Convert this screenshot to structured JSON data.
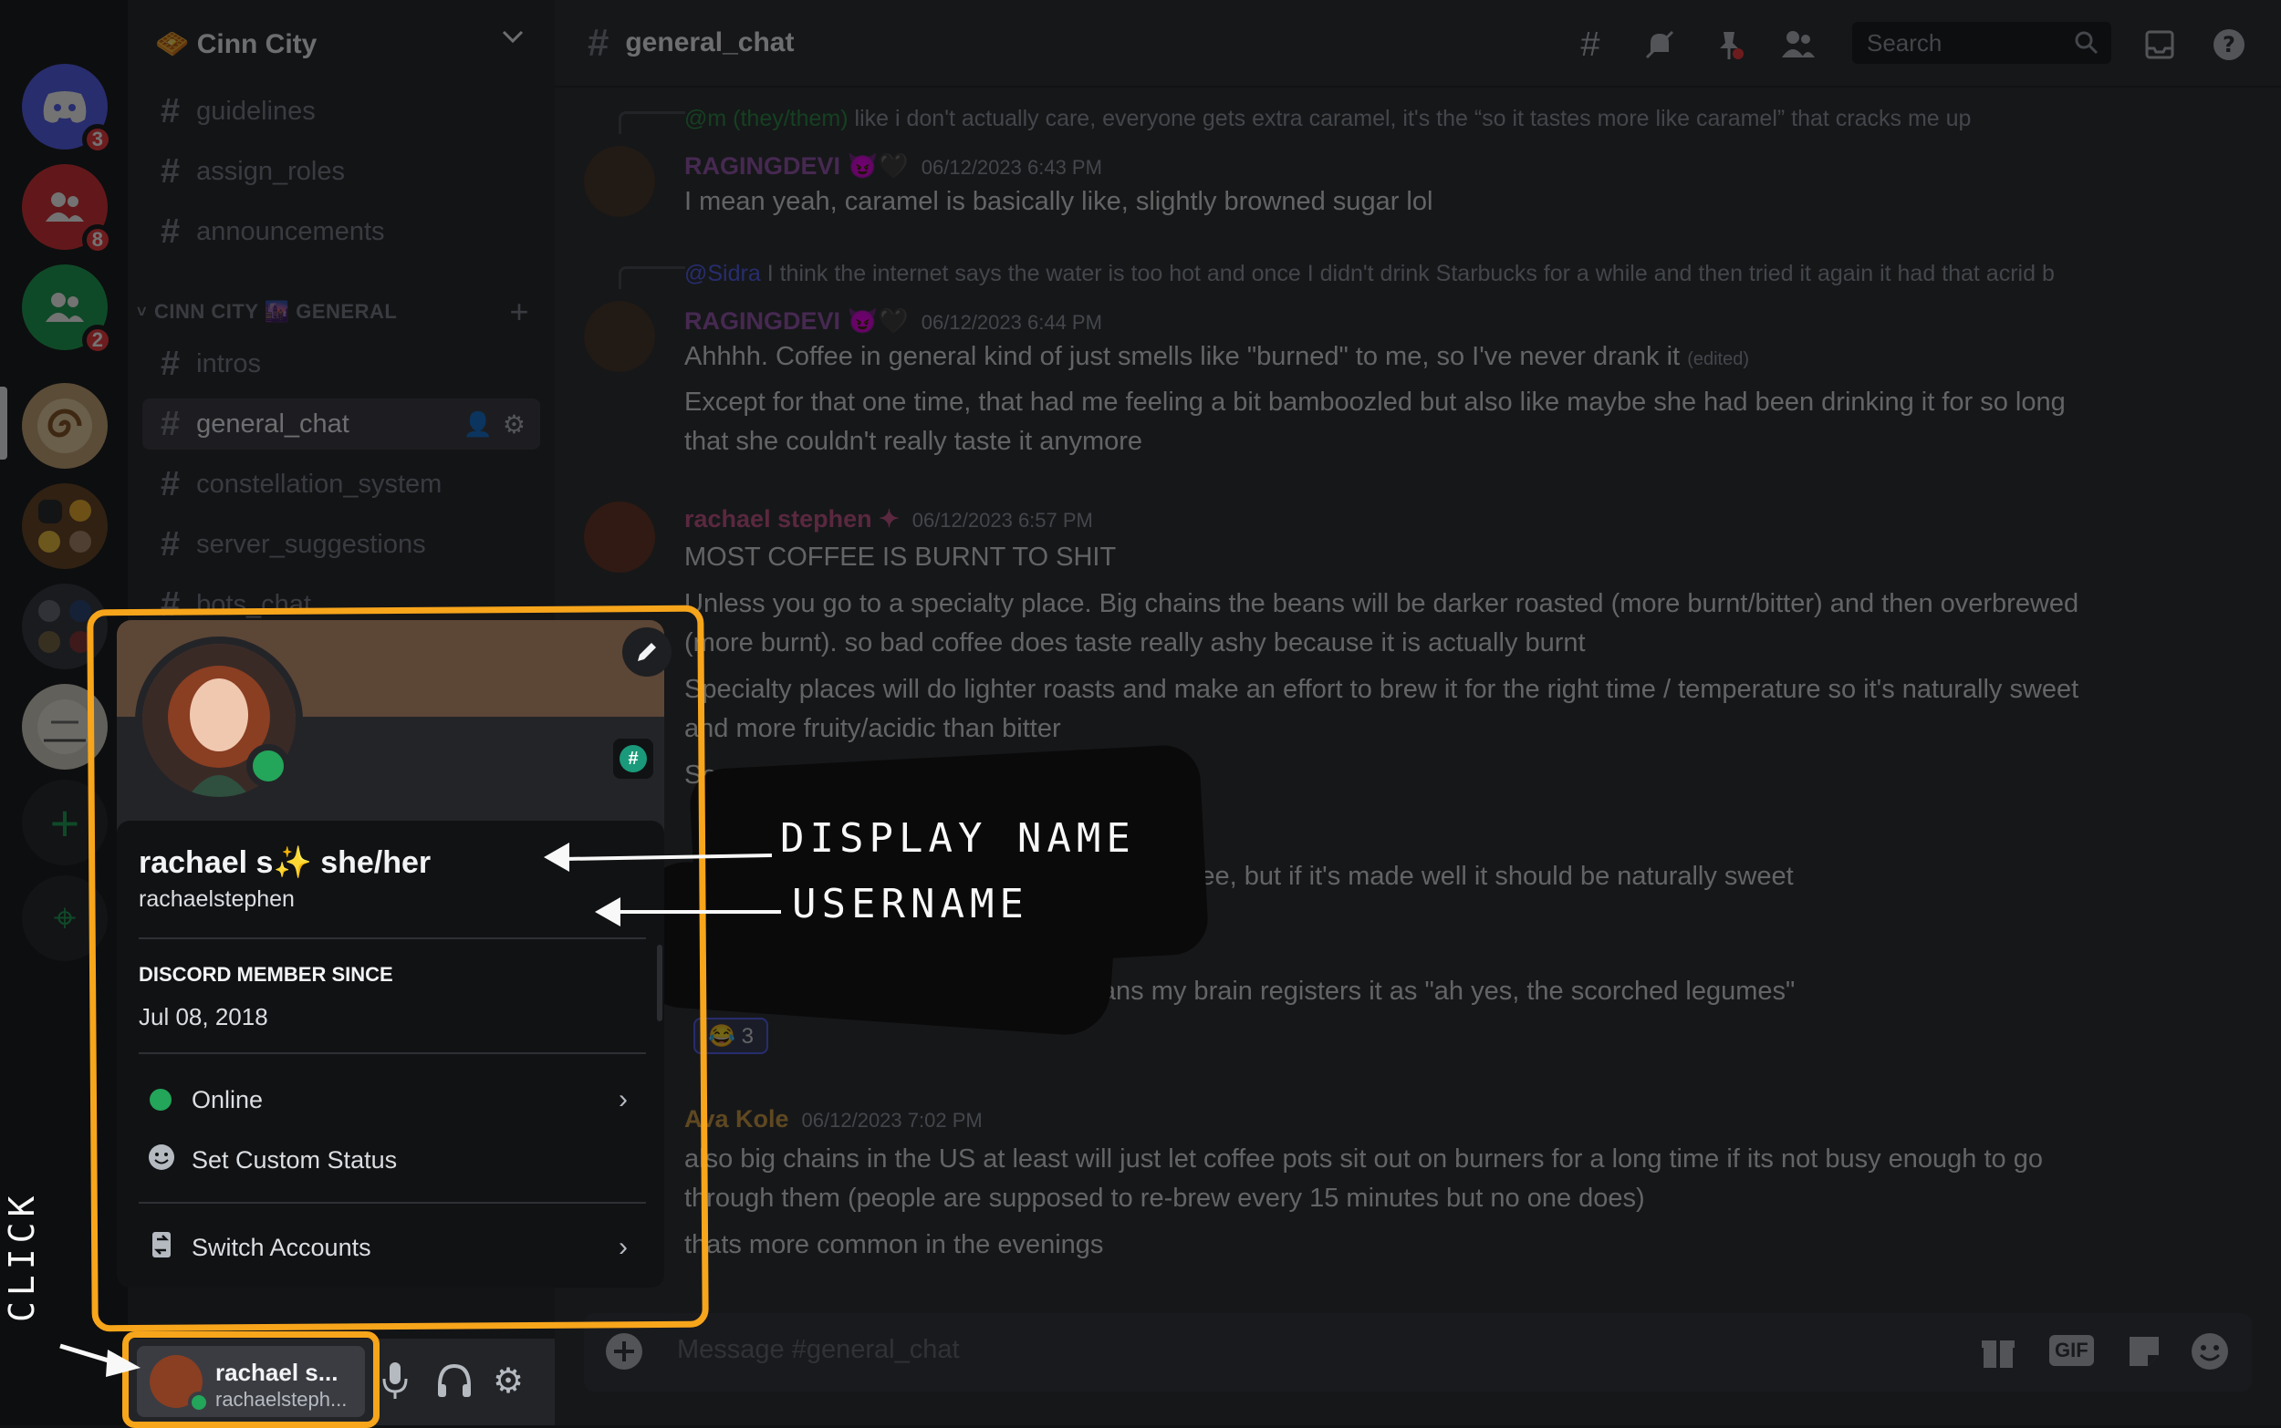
{
  "server_rail": {
    "servers": [
      {
        "name": "home",
        "badge": "3",
        "color": "#5865f2"
      },
      {
        "name": "red-group",
        "badge": "8",
        "color": "#da373c"
      },
      {
        "name": "green-group",
        "badge": "2",
        "color": "#23a55a"
      },
      {
        "name": "cinn-city",
        "badge": "",
        "color": "#c9a97a"
      },
      {
        "name": "crit",
        "badge": "",
        "color": "#6b4b2a"
      },
      {
        "name": "discord-group",
        "badge": "",
        "color": "#3b3d46"
      },
      {
        "name": "the-shop",
        "badge": "",
        "color": "#d8d4c8"
      }
    ],
    "add_label": "+",
    "explore_label": "⌖"
  },
  "sidebar": {
    "server_name": "🧇 Cinn City",
    "channels_top": [
      "guidelines",
      "assign_roles",
      "announcements"
    ],
    "category": "CINN CITY 🌆 GENERAL",
    "channels": [
      "intros",
      "general_chat",
      "constellation_system",
      "server_suggestions",
      "bots_chat"
    ]
  },
  "header": {
    "channel": "general_chat",
    "search_placeholder": "Search"
  },
  "messages": [
    {
      "reply_user": "@m (they/them)",
      "reply_text": "like i don't actually care, everyone gets extra caramel, it's the “so it tastes more like caramel” that cracks me up",
      "author": "RAGINGDEVI 😈🖤",
      "author_color": "#9c5bb3",
      "time": "06/12/2023 6:43 PM",
      "lines": [
        "I mean yeah, caramel is basically like, slightly browned sugar lol"
      ]
    },
    {
      "reply_user": "@Sidra",
      "reply_text": "I think the internet says the water is too hot and once I didn't drink Starbucks for a while and then tried it again it had that acrid b",
      "author": "RAGINGDEVI 😈🖤",
      "author_color": "#9c5bb3",
      "time": "06/12/2023 6:44 PM",
      "lines": [
        "Ahhhh. Coffee in general kind of just smells like \"burned\" to me, so I've never drank it",
        "Except for that one time, that had me feeling a bit bamboozled but also like maybe she had been drinking it for so long",
        "that she couldn't really taste it anymore"
      ],
      "edited": "(edited)"
    },
    {
      "author": "rachael stephen ✦",
      "author_color": "#c85a8c",
      "time": "06/12/2023 6:57 PM",
      "lines": [
        "MOST COFFEE IS BURNT TO SHIT",
        "Unless you go to a specialty place. Big chains the beans will be darker roasted (more burnt/bitter) and then overbrewed",
        "(more burnt). so bad coffee does taste really ashy because it is actually burnt",
        "Specialty places will do lighter roasts and make an effort to brew it for the right time / temperature so it's naturally sweet",
        "and more fruity/acidic than bitter",
        "Sorry possessed by my past barista self)"
      ]
    },
    {
      "lines": [
        "ness of lower grade coffee, but if it's made well it should be naturally sweet",
        "think because it's all just roasted beans my brain registers it as \"ah yes, the scorched legumes\""
      ],
      "reaction": "😂 3"
    },
    {
      "author": "Ava Kole",
      "author_color": "#d3a14a",
      "time": "06/12/2023 7:02 PM",
      "lines": [
        "also big chains in the US at least will just let coffee pots sit out on burners for a long time if its not busy enough to go",
        "through them (people are supposed to re-brew every 15 minutes but no one does)",
        "thats more common in the evenings"
      ]
    }
  ],
  "composer": {
    "placeholder": "Message #general_chat",
    "gif": "GIF"
  },
  "profile": {
    "display_name": "rachael s✨ she/her",
    "username": "rachaelstephen",
    "member_since_label": "DISCORD MEMBER SINCE",
    "member_since": "Jul 08, 2018",
    "status": "Online",
    "custom_status": "Set Custom Status",
    "switch_accounts": "Switch Accounts",
    "status_color": "#23a55a",
    "badge": "#"
  },
  "user_panel": {
    "name": "rachael s...",
    "username": "rachaelsteph..."
  },
  "annotations": {
    "display_name": "DISPLAY NAME",
    "username": "USERNAME",
    "click": "CLICK",
    "highlight_color": "#f7a51b"
  }
}
